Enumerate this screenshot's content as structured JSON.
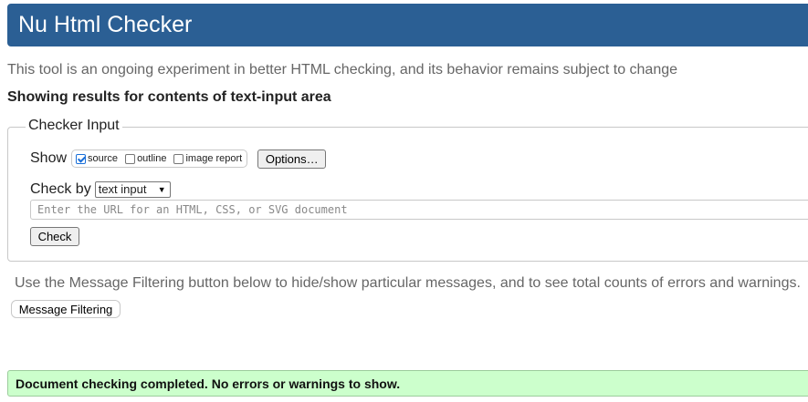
{
  "header": {
    "title": "Nu Html Checker"
  },
  "intro": {
    "text": "This tool is an ongoing experiment in better HTML checking, and its behavior remains subject to change"
  },
  "results_heading": "Showing results for contents of text-input area",
  "checker_input": {
    "legend": "Checker Input",
    "show_label": "Show",
    "options": [
      {
        "label": "source",
        "checked": true
      },
      {
        "label": "outline",
        "checked": false
      },
      {
        "label": "image report",
        "checked": false
      }
    ],
    "options_button": "Options…",
    "check_by_label": "Check by",
    "check_by_value": "text input",
    "url_placeholder": "Enter the URL for an HTML, CSS, or SVG document",
    "check_button": "Check"
  },
  "filtering": {
    "hint": "Use the Message Filtering button below to hide/show particular messages, and to see total counts of errors and warnings.",
    "button": "Message Filtering"
  },
  "status": {
    "message": "Document checking completed. No errors or warnings to show.",
    "color": "#ccffcc"
  },
  "colors": {
    "header_bg": "#2b5f94"
  }
}
